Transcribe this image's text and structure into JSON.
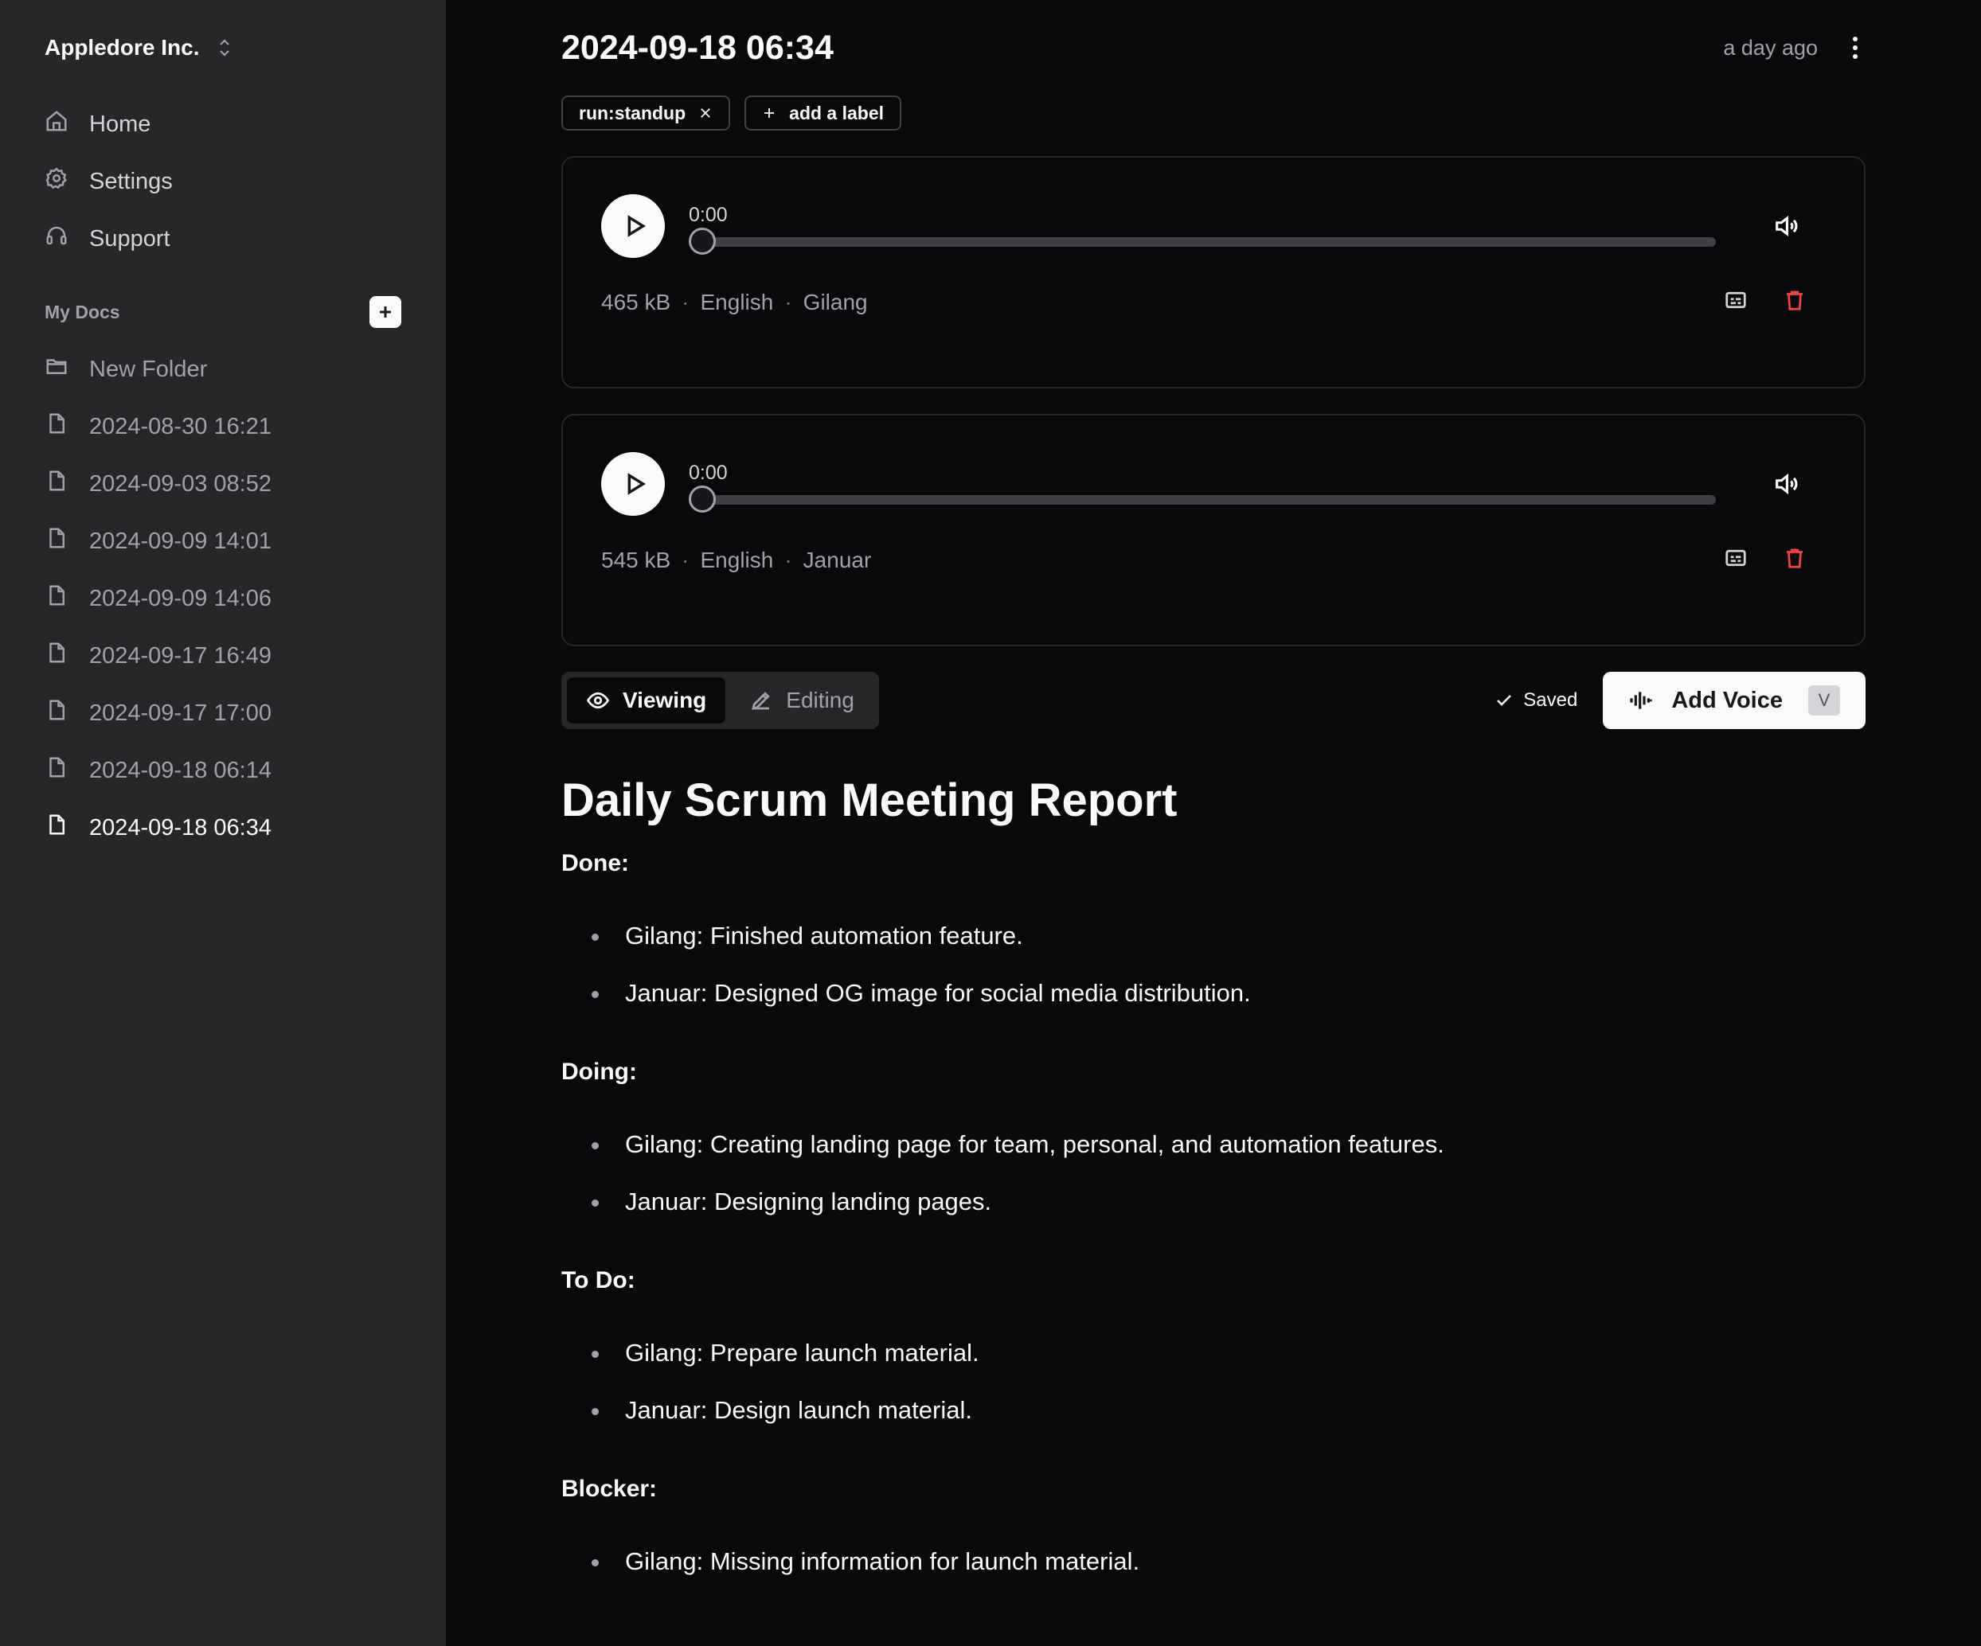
{
  "sidebar": {
    "org_name": "Appledore Inc.",
    "nav": [
      {
        "label": "Home",
        "icon": "home-icon"
      },
      {
        "label": "Settings",
        "icon": "gear-icon"
      },
      {
        "label": "Support",
        "icon": "headset-icon"
      }
    ],
    "section_title": "My Docs",
    "folder": {
      "label": "New Folder",
      "icon": "folder-icon"
    },
    "docs": [
      "2024-08-30 16:21",
      "2024-09-03 08:52",
      "2024-09-09 14:01",
      "2024-09-09 14:06",
      "2024-09-17 16:49",
      "2024-09-17 17:00",
      "2024-09-18 06:14",
      "2024-09-18 06:34"
    ],
    "active_doc": "2024-09-18 06:34"
  },
  "header": {
    "title": "2024-09-18 06:34",
    "updated": "a day ago"
  },
  "labels": {
    "chip": "run:standup",
    "add": "add a label"
  },
  "recordings": [
    {
      "time": "0:00",
      "progress": 0,
      "size": "465 kB",
      "language": "English",
      "speaker": "Gilang"
    },
    {
      "time": "0:00",
      "progress": 0,
      "size": "545 kB",
      "language": "English",
      "speaker": "Januar"
    }
  ],
  "toolbar": {
    "viewing": "Viewing",
    "editing": "Editing",
    "mode": "viewing",
    "saved": "Saved",
    "add_voice": "Add Voice",
    "shortcut": "V"
  },
  "document": {
    "heading": "Daily Scrum Meeting Report",
    "sections": [
      {
        "title": "Done:",
        "items": [
          "Gilang: Finished automation feature.",
          "Januar: Designed OG image for social media distribution."
        ]
      },
      {
        "title": "Doing:",
        "items": [
          "Gilang: Creating landing page for team, personal, and automation features.",
          "Januar: Designing landing pages."
        ]
      },
      {
        "title": "To Do:",
        "items": [
          "Gilang: Prepare launch material.",
          "Januar: Design launch material."
        ]
      },
      {
        "title": "Blocker:",
        "items": [
          "Gilang: Missing information for launch material."
        ]
      }
    ]
  },
  "colors": {
    "sidebar_bg": "#27272a",
    "main_bg": "#09090b",
    "delete": "#ef4444",
    "text": "#fafafa",
    "muted": "#a1a1aa"
  }
}
